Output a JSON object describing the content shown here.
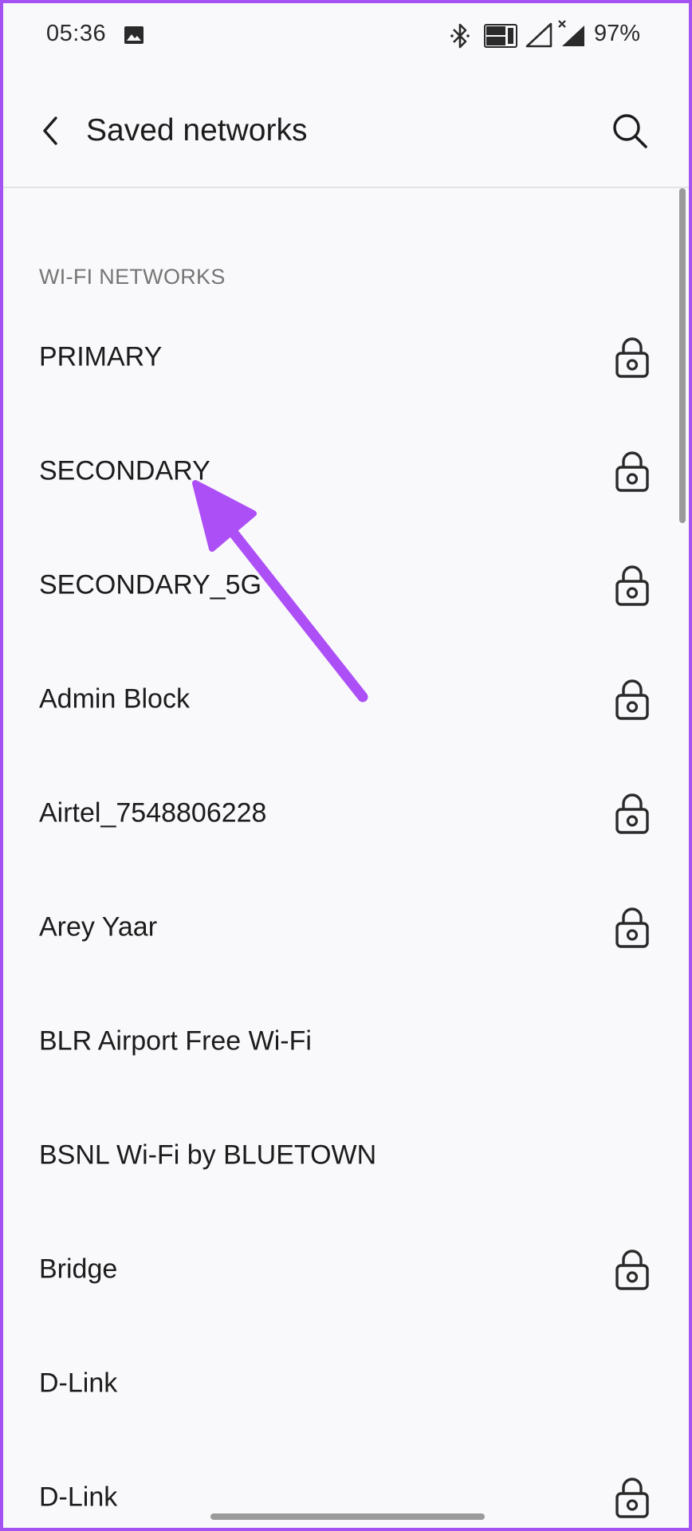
{
  "status_bar": {
    "time": "05:36",
    "battery": "97%",
    "icons": [
      "gallery-icon",
      "bluetooth-icon",
      "volte-icon",
      "signal-icon",
      "signal-no-service-icon"
    ]
  },
  "app_bar": {
    "title": "Saved networks",
    "back_icon": "back-arrow-icon",
    "search_icon": "search-icon"
  },
  "section_header": "WI-FI NETWORKS",
  "networks": [
    {
      "name": "PRIMARY",
      "secured": true
    },
    {
      "name": "SECONDARY",
      "secured": true
    },
    {
      "name": "SECONDARY_5G",
      "secured": true
    },
    {
      "name": "Admin Block",
      "secured": true
    },
    {
      "name": "Airtel_7548806228",
      "secured": true
    },
    {
      "name": "Arey Yaar",
      "secured": true
    },
    {
      "name": "BLR Airport Free Wi-Fi",
      "secured": false
    },
    {
      "name": "BSNL Wi-Fi by BLUETOWN",
      "secured": false
    },
    {
      "name": "Bridge",
      "secured": true
    },
    {
      "name": "D-Link",
      "secured": false
    },
    {
      "name": "D-Link",
      "secured": true
    }
  ],
  "colors": {
    "background": "#f9f9fb",
    "frame": "#a452f2",
    "annotation_arrow": "#ad4ff6",
    "text": "#1c1c1c",
    "secondary_text": "#757575"
  }
}
